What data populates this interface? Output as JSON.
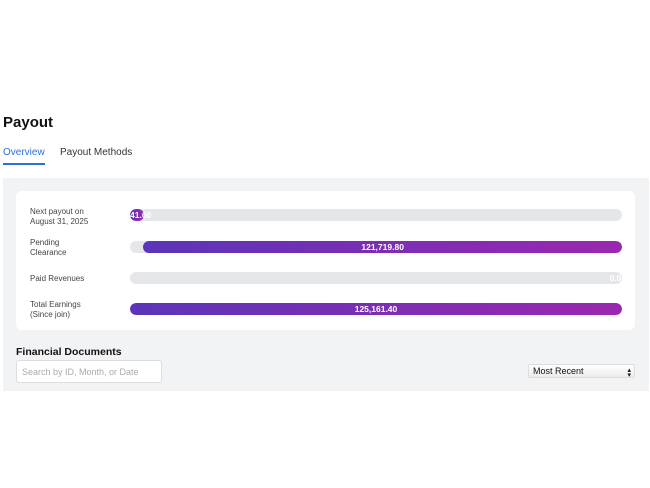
{
  "page": {
    "title": "Payout"
  },
  "tabs": [
    {
      "label": "Overview",
      "active": true
    },
    {
      "label": "Payout Methods",
      "active": false
    }
  ],
  "summary": {
    "accent_gradient": [
      "#5b35b8",
      "#9b27b0"
    ],
    "rows": [
      {
        "label1": "Next payout on",
        "label2": "August 31, 2025",
        "value": "41.60",
        "fill_percent": 2.7
      },
      {
        "label1": "Pending",
        "label2": "Clearance",
        "value": "121,719.80",
        "fill_percent": 97.3
      },
      {
        "label1": "Paid Revenues",
        "label2": "",
        "value": "0.00",
        "fill_percent": 0
      },
      {
        "label1": "Total Earnings",
        "label2": "(Since join)",
        "value": "125,161.40",
        "fill_percent": 100
      }
    ]
  },
  "documents": {
    "title": "Financial Documents",
    "search_placeholder": "Search by ID, Month, or Date",
    "sort_value": "Most Recent"
  }
}
